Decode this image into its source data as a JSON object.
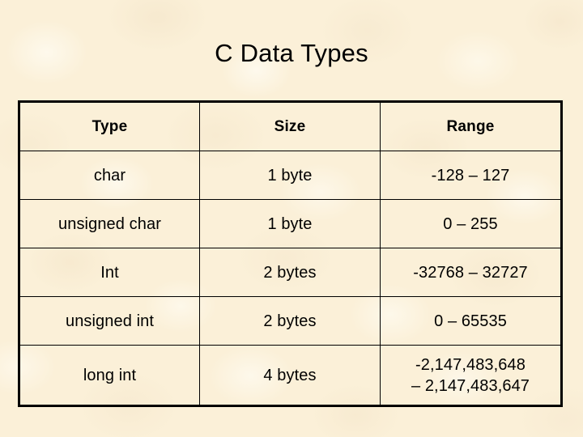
{
  "slide": {
    "title": "C Data Types",
    "background_color": "#fbf0d8",
    "text_color": "#000000",
    "border_color": "#000000"
  },
  "table": {
    "headers": {
      "type": "Type",
      "size": "Size",
      "range": "Range"
    },
    "rows": [
      {
        "type": "char",
        "size": "1 byte",
        "range_line1": "-128 – 127",
        "range_line2": ""
      },
      {
        "type": "unsigned char",
        "size": "1 byte",
        "range_line1": "0 – 255",
        "range_line2": ""
      },
      {
        "type": "Int",
        "size": "2 bytes",
        "range_line1": "-32768 – 32727",
        "range_line2": ""
      },
      {
        "type": "unsigned int",
        "size": "2 bytes",
        "range_line1": "0 – 65535",
        "range_line2": ""
      },
      {
        "type": "long int",
        "size": "4 bytes",
        "range_line1": "-2,147,483,648",
        "range_line2": "– 2,147,483,647"
      }
    ]
  }
}
